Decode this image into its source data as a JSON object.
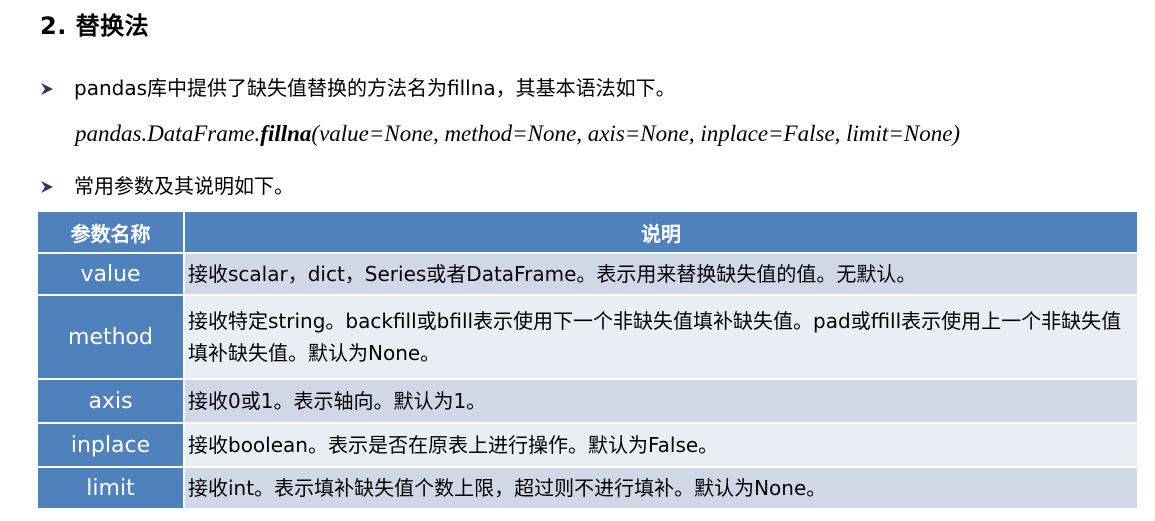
{
  "heading": "2. 替换法",
  "bullet1": "pandas库中提供了缺失值替换的方法名为fillna，其基本语法如下。",
  "syntax": {
    "prefix": "pandas.DataFrame.",
    "method": "fillna",
    "args": "(value=None, method=None, axis=None, inplace=False, limit=None)"
  },
  "bullet2": "常用参数及其说明如下。",
  "table": {
    "headers": [
      "参数名称",
      "说明"
    ],
    "rows": [
      {
        "name": "value",
        "desc": "接收scalar，dict，Series或者DataFrame。表示用来替换缺失值的值。无默认。"
      },
      {
        "name": "method",
        "desc": "接收特定string。backfill或bfill表示使用下一个非缺失值填补缺失值。pad或ffill表示使用上一个非缺失值填补缺失值。默认为None。"
      },
      {
        "name": "axis",
        "desc": "接收0或1。表示轴向。默认为1。"
      },
      {
        "name": "inplace",
        "desc": "接收boolean。表示是否在原表上进行操作。默认为False。"
      },
      {
        "name": "limit",
        "desc": "接收int。表示填补缺失值个数上限，超过则不进行填补。默认为None。"
      }
    ]
  },
  "colors": {
    "header_blue": "#4f81bd",
    "row_band_dark": "#d0d8e8",
    "row_band_light": "#e9edf4",
    "bullet_arrow": "#1f3864"
  },
  "icons": {
    "bullet": "right-arrow-bullet-icon"
  }
}
